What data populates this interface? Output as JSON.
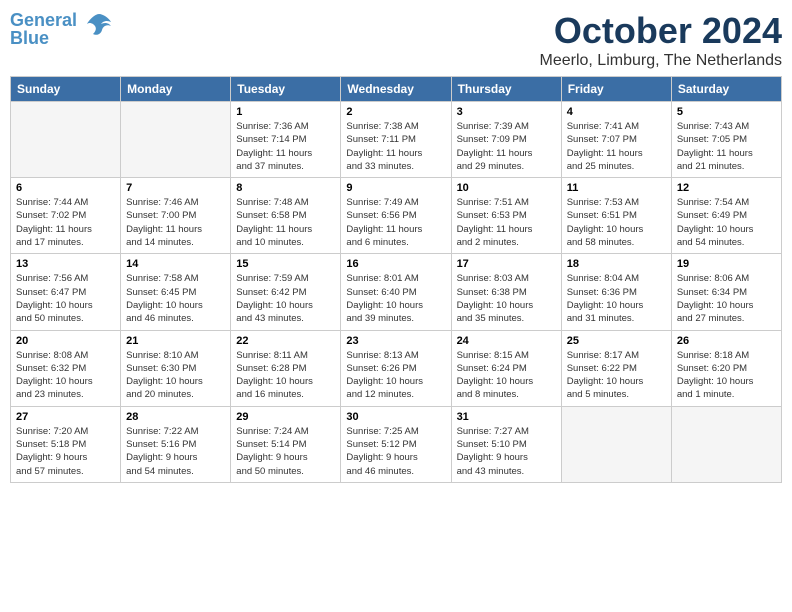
{
  "header": {
    "logo_line1": "General",
    "logo_line2": "Blue",
    "month_title": "October 2024",
    "subtitle": "Meerlo, Limburg, The Netherlands"
  },
  "days_of_week": [
    "Sunday",
    "Monday",
    "Tuesday",
    "Wednesday",
    "Thursday",
    "Friday",
    "Saturday"
  ],
  "weeks": [
    {
      "shade": false,
      "days": [
        {
          "num": "",
          "detail": ""
        },
        {
          "num": "",
          "detail": ""
        },
        {
          "num": "1",
          "detail": "Sunrise: 7:36 AM\nSunset: 7:14 PM\nDaylight: 11 hours\nand 37 minutes."
        },
        {
          "num": "2",
          "detail": "Sunrise: 7:38 AM\nSunset: 7:11 PM\nDaylight: 11 hours\nand 33 minutes."
        },
        {
          "num": "3",
          "detail": "Sunrise: 7:39 AM\nSunset: 7:09 PM\nDaylight: 11 hours\nand 29 minutes."
        },
        {
          "num": "4",
          "detail": "Sunrise: 7:41 AM\nSunset: 7:07 PM\nDaylight: 11 hours\nand 25 minutes."
        },
        {
          "num": "5",
          "detail": "Sunrise: 7:43 AM\nSunset: 7:05 PM\nDaylight: 11 hours\nand 21 minutes."
        }
      ]
    },
    {
      "shade": true,
      "days": [
        {
          "num": "6",
          "detail": "Sunrise: 7:44 AM\nSunset: 7:02 PM\nDaylight: 11 hours\nand 17 minutes."
        },
        {
          "num": "7",
          "detail": "Sunrise: 7:46 AM\nSunset: 7:00 PM\nDaylight: 11 hours\nand 14 minutes."
        },
        {
          "num": "8",
          "detail": "Sunrise: 7:48 AM\nSunset: 6:58 PM\nDaylight: 11 hours\nand 10 minutes."
        },
        {
          "num": "9",
          "detail": "Sunrise: 7:49 AM\nSunset: 6:56 PM\nDaylight: 11 hours\nand 6 minutes."
        },
        {
          "num": "10",
          "detail": "Sunrise: 7:51 AM\nSunset: 6:53 PM\nDaylight: 11 hours\nand 2 minutes."
        },
        {
          "num": "11",
          "detail": "Sunrise: 7:53 AM\nSunset: 6:51 PM\nDaylight: 10 hours\nand 58 minutes."
        },
        {
          "num": "12",
          "detail": "Sunrise: 7:54 AM\nSunset: 6:49 PM\nDaylight: 10 hours\nand 54 minutes."
        }
      ]
    },
    {
      "shade": false,
      "days": [
        {
          "num": "13",
          "detail": "Sunrise: 7:56 AM\nSunset: 6:47 PM\nDaylight: 10 hours\nand 50 minutes."
        },
        {
          "num": "14",
          "detail": "Sunrise: 7:58 AM\nSunset: 6:45 PM\nDaylight: 10 hours\nand 46 minutes."
        },
        {
          "num": "15",
          "detail": "Sunrise: 7:59 AM\nSunset: 6:42 PM\nDaylight: 10 hours\nand 43 minutes."
        },
        {
          "num": "16",
          "detail": "Sunrise: 8:01 AM\nSunset: 6:40 PM\nDaylight: 10 hours\nand 39 minutes."
        },
        {
          "num": "17",
          "detail": "Sunrise: 8:03 AM\nSunset: 6:38 PM\nDaylight: 10 hours\nand 35 minutes."
        },
        {
          "num": "18",
          "detail": "Sunrise: 8:04 AM\nSunset: 6:36 PM\nDaylight: 10 hours\nand 31 minutes."
        },
        {
          "num": "19",
          "detail": "Sunrise: 8:06 AM\nSunset: 6:34 PM\nDaylight: 10 hours\nand 27 minutes."
        }
      ]
    },
    {
      "shade": true,
      "days": [
        {
          "num": "20",
          "detail": "Sunrise: 8:08 AM\nSunset: 6:32 PM\nDaylight: 10 hours\nand 23 minutes."
        },
        {
          "num": "21",
          "detail": "Sunrise: 8:10 AM\nSunset: 6:30 PM\nDaylight: 10 hours\nand 20 minutes."
        },
        {
          "num": "22",
          "detail": "Sunrise: 8:11 AM\nSunset: 6:28 PM\nDaylight: 10 hours\nand 16 minutes."
        },
        {
          "num": "23",
          "detail": "Sunrise: 8:13 AM\nSunset: 6:26 PM\nDaylight: 10 hours\nand 12 minutes."
        },
        {
          "num": "24",
          "detail": "Sunrise: 8:15 AM\nSunset: 6:24 PM\nDaylight: 10 hours\nand 8 minutes."
        },
        {
          "num": "25",
          "detail": "Sunrise: 8:17 AM\nSunset: 6:22 PM\nDaylight: 10 hours\nand 5 minutes."
        },
        {
          "num": "26",
          "detail": "Sunrise: 8:18 AM\nSunset: 6:20 PM\nDaylight: 10 hours\nand 1 minute."
        }
      ]
    },
    {
      "shade": false,
      "days": [
        {
          "num": "27",
          "detail": "Sunrise: 7:20 AM\nSunset: 5:18 PM\nDaylight: 9 hours\nand 57 minutes."
        },
        {
          "num": "28",
          "detail": "Sunrise: 7:22 AM\nSunset: 5:16 PM\nDaylight: 9 hours\nand 54 minutes."
        },
        {
          "num": "29",
          "detail": "Sunrise: 7:24 AM\nSunset: 5:14 PM\nDaylight: 9 hours\nand 50 minutes."
        },
        {
          "num": "30",
          "detail": "Sunrise: 7:25 AM\nSunset: 5:12 PM\nDaylight: 9 hours\nand 46 minutes."
        },
        {
          "num": "31",
          "detail": "Sunrise: 7:27 AM\nSunset: 5:10 PM\nDaylight: 9 hours\nand 43 minutes."
        },
        {
          "num": "",
          "detail": ""
        },
        {
          "num": "",
          "detail": ""
        }
      ]
    }
  ]
}
